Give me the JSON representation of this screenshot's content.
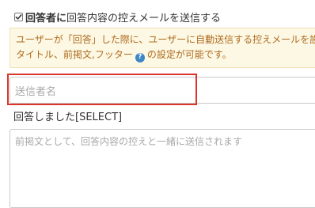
{
  "reply_email": {
    "checked": true,
    "label_bold": "回答者に",
    "label_rest": "回答内容の控えメールを送信する"
  },
  "notice": {
    "line1": "ユーザーが「回答」した際に、ユーザーに自動送信する控えメールを設",
    "line2_before": "タイトル、前掲文,フッター",
    "help_icon_symbol": "?",
    "line2_after": "の設定が可能です。"
  },
  "sender_name": {
    "placeholder": "送信者名",
    "value": ""
  },
  "subject": {
    "text": "回答しました[SELECT]"
  },
  "preface": {
    "placeholder": "前掲文として、回答内容の控えと一緒に送信されます"
  },
  "colors": {
    "notice_bg": "#fcf8e3",
    "notice_text": "#b06b20",
    "highlight_border": "#d9352a",
    "help_icon": "#3d86c6"
  }
}
